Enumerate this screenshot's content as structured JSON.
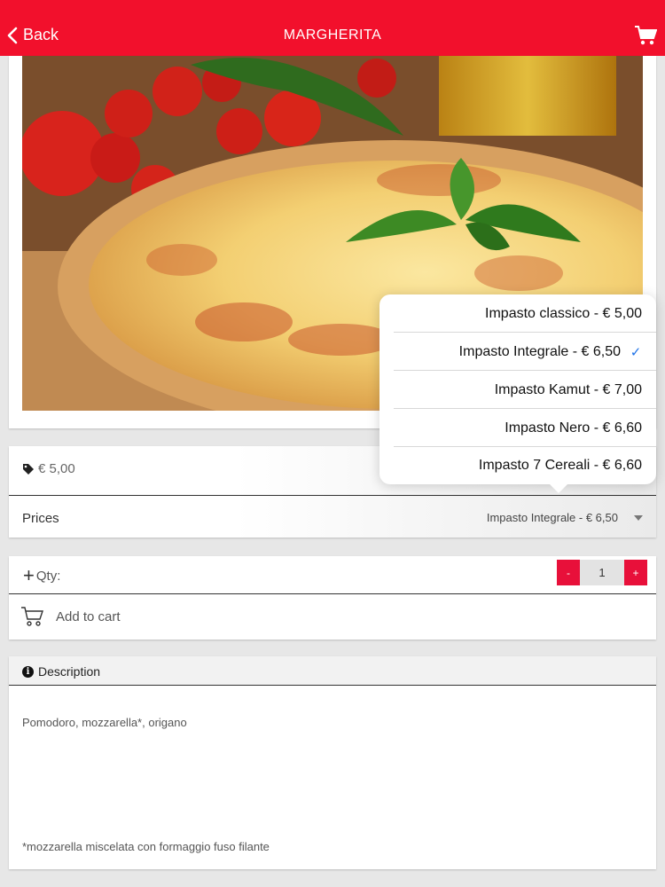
{
  "header": {
    "back_label": "Back",
    "title": "MARGHERITA"
  },
  "product": {
    "price": "€ 5,00",
    "prices_label": "Prices",
    "selected_price_option": "Impasto Integrale - € 6,50",
    "qty_label": "Qty:",
    "qty_minus": "-",
    "qty_plus": "+",
    "qty_value": "1",
    "add_to_cart_label": "Add to cart"
  },
  "description": {
    "heading": "Description",
    "text": "Pomodoro, mozzarella*, origano",
    "note": "*mozzarella miscelata con formaggio fuso filante"
  },
  "price_options": [
    {
      "label": "Impasto classico - € 5,00",
      "selected": false
    },
    {
      "label": "Impasto Integrale - € 6,50",
      "selected": true
    },
    {
      "label": "Impasto Kamut - € 7,00",
      "selected": false
    },
    {
      "label": "Impasto Nero - € 6,60",
      "selected": false
    },
    {
      "label": "Impasto 7 Cereali - € 6,60",
      "selected": false
    }
  ],
  "icons": {
    "back": "chevron-left-icon",
    "cart_top": "cart-icon",
    "price_tag": "tag-icon",
    "add_to_cart": "cart-outline-icon",
    "description": "info-icon",
    "selected_check": "checkmark-icon"
  },
  "colors": {
    "accent": "#f2102c",
    "stepper": "#e8103a",
    "check": "#1f73e8"
  }
}
